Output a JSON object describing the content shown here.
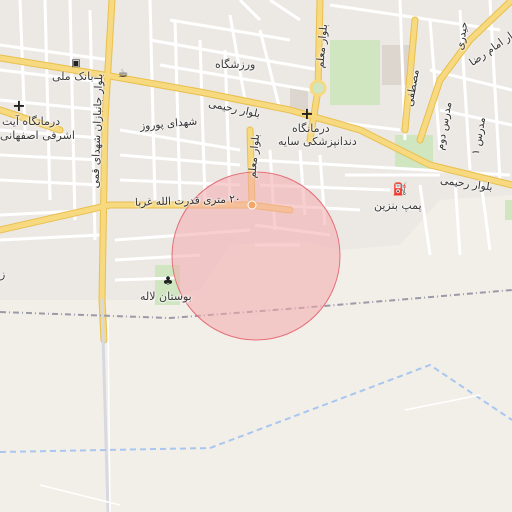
{
  "map": {
    "labels": {
      "bank_melli": "بانک ملی",
      "varzeshgah": "ورزشگاه",
      "blvd_moallem": "بلوار معلم",
      "blvd_emam_reza": "بلوار امام رضا",
      "heydari": "حیدری",
      "clinic_ayat": "درمانگاه آیت",
      "ashrafi_esfahani": "اشرفی اصفهانی",
      "blvd_rahimi_left": "بلوار رحیمی",
      "shahid_poorvar": "شهدای پوروز",
      "clinic_saye_1": "درمانگاه",
      "clinic_saye_2": "دندانپزشکی سایه",
      "mostafa": "مصطفی",
      "modarres": "مدرس دوم",
      "modarres_1": "مدرس ۱",
      "blvd_rahimi_right": "بلوار رحیمی",
      "blvd_janbazan": "بلوار جانبازان شهدای قمی",
      "moallem_2": "بلوار معلم",
      "qodratollah": "۲۰ متری قدرت الله غربا",
      "gas_station": "پمپ بنزین",
      "boostan_laleh": "بوستان لاله",
      "edge_z": "ز"
    },
    "icons": {
      "bank": "bank-icon",
      "cafe": "cafe-icon",
      "hospital": "hospital-cross-icon",
      "fuel": "fuel-pump-icon",
      "park": "tree-icon",
      "roundabout": "roundabout-icon"
    },
    "colors": {
      "background": "#f2efe9",
      "primary_road": "#f7d980",
      "primary_road_casing": "#e9bf4e",
      "residential": "#ffffff",
      "green": "#cfe6c0",
      "building": "#d9d0c9",
      "boundary": "#9b9aa6",
      "waterway": "#a9c6f0",
      "radius_fill": "#f4a9ad",
      "radius_stroke": "#e5707a"
    }
  }
}
